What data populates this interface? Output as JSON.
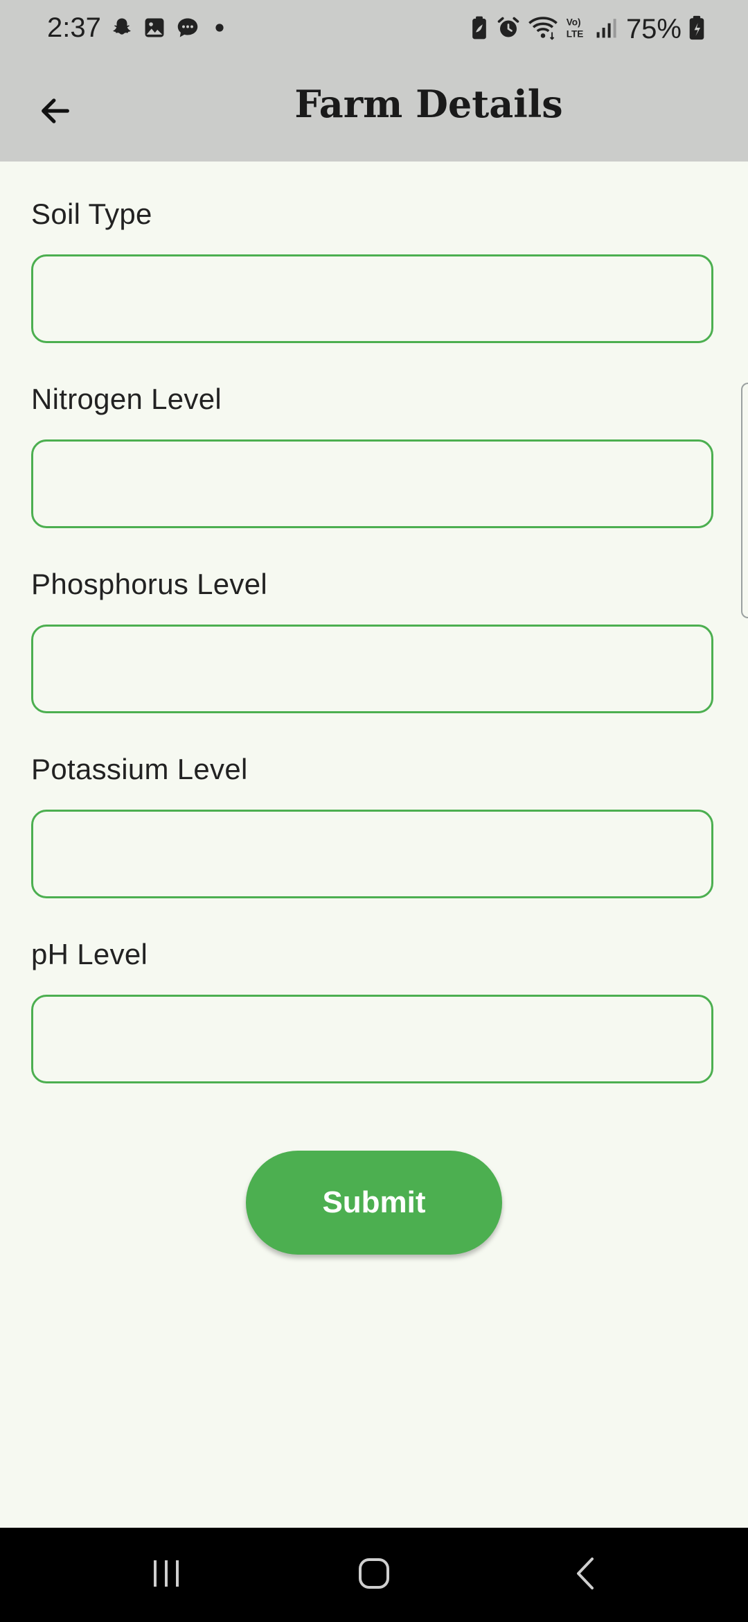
{
  "status_bar": {
    "time": "2:37",
    "battery_percent": "75%",
    "left_icons": [
      "snapchat-icon",
      "gallery-icon",
      "message-icon",
      "dot-icon"
    ],
    "right_icons": [
      "battery-saver-icon",
      "alarm-icon",
      "wifi-icon",
      "volte-icon",
      "signal-icon",
      "battery-icon"
    ]
  },
  "app_bar": {
    "title": "Farm Details",
    "back_icon": "arrow-left-icon"
  },
  "form": {
    "fields": [
      {
        "label": "Soil Type",
        "value": "",
        "placeholder": ""
      },
      {
        "label": "Nitrogen Level",
        "value": "",
        "placeholder": ""
      },
      {
        "label": "Phosphorus Level",
        "value": "",
        "placeholder": ""
      },
      {
        "label": "Potassium Level",
        "value": "",
        "placeholder": ""
      },
      {
        "label": "pH Level",
        "value": "",
        "placeholder": ""
      }
    ],
    "submit_label": "Submit"
  },
  "navigation_bar": {
    "buttons": [
      "recents-icon",
      "home-icon",
      "back-icon"
    ]
  },
  "colors": {
    "accent": "#4caf50",
    "background": "#f6f9f1",
    "app_bar": "#cbccca",
    "nav_bar": "#000000"
  }
}
